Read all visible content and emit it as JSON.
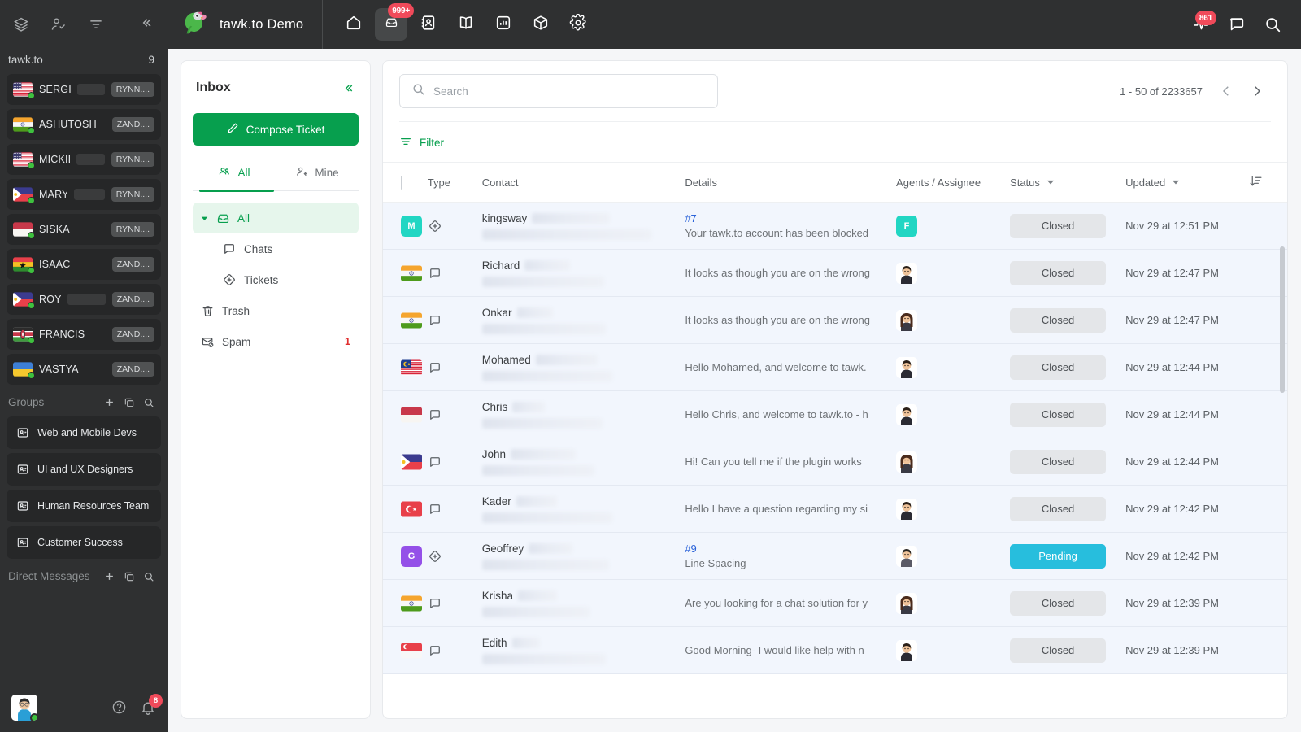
{
  "sidebar": {
    "toolbar_icons": [
      "layers-icon",
      "user-check-icon",
      "filter-icon",
      "collapse-left-icon"
    ],
    "property": {
      "title": "tawk.to",
      "count": "9"
    },
    "contacts": [
      {
        "name": "SERGIO",
        "flag": "us",
        "tag": "RYNN....",
        "redacted": true,
        "redact_w": 44
      },
      {
        "name": "ASHUTOSH",
        "flag": "in",
        "tag": "ZAND....",
        "redacted": false,
        "redact_w": 0
      },
      {
        "name": "MICKIE",
        "flag": "us",
        "tag": "RYNN....",
        "redacted": true,
        "redact_w": 40
      },
      {
        "name": "MARY",
        "flag": "ph",
        "tag": "RYNN....",
        "redacted": true,
        "redact_w": 40
      },
      {
        "name": "SISKA",
        "flag": "id",
        "tag": "RYNN....",
        "redacted": false,
        "redact_w": 0
      },
      {
        "name": "ISAAC",
        "flag": "gh",
        "tag": "ZAND....",
        "redacted": false,
        "redact_w": 0
      },
      {
        "name": "ROY",
        "flag": "ph",
        "tag": "ZAND....",
        "redacted": true,
        "redact_w": 48
      },
      {
        "name": "FRANCIS",
        "flag": "ke",
        "tag": "ZAND....",
        "redacted": false,
        "redact_w": 0
      },
      {
        "name": "VASTYA",
        "flag": "ua",
        "tag": "ZAND....",
        "redacted": false,
        "redact_w": 0
      }
    ],
    "groups_header": {
      "label": "Groups",
      "actions": [
        "add-icon",
        "copy-icon",
        "search-icon"
      ]
    },
    "groups": [
      {
        "label": "Web and Mobile Devs"
      },
      {
        "label": "UI and UX Designers"
      },
      {
        "label": "Human Resources Team"
      },
      {
        "label": "Customer Success"
      }
    ],
    "direct_messages_header": {
      "label": "Direct Messages",
      "actions": [
        "add-icon",
        "copy-icon",
        "search-icon"
      ]
    },
    "bottom": {
      "help_icon": "help-circle-icon",
      "bell_icon": "bell-icon",
      "bell_badge": "8"
    }
  },
  "topbar": {
    "brand": "tawk.to Demo",
    "logo_icon": "parrot-logo-icon",
    "nav": [
      {
        "name": "home-icon",
        "badge": "",
        "active": false
      },
      {
        "name": "inbox-icon",
        "badge": "999+",
        "active": true
      },
      {
        "name": "contacts-icon",
        "badge": "",
        "active": false
      },
      {
        "name": "knowledge-base-icon",
        "badge": "",
        "active": false
      },
      {
        "name": "monitoring-icon",
        "badge": "",
        "active": false
      },
      {
        "name": "apps-icon",
        "badge": "",
        "active": false
      },
      {
        "name": "settings-icon",
        "badge": "",
        "active": false
      }
    ],
    "right": [
      {
        "name": "activity-icon",
        "badge": "861"
      },
      {
        "name": "chat-icon",
        "badge": ""
      },
      {
        "name": "search-icon",
        "badge": ""
      }
    ]
  },
  "inbox": {
    "title": "Inbox",
    "collapse_icon": "collapse-left-icon",
    "compose_label": "Compose Ticket",
    "compose_icon": "pencil-icon",
    "tabs": [
      {
        "label": "All",
        "icon": "people-icon",
        "active": true
      },
      {
        "label": "Mine",
        "icon": "person-in-icon",
        "active": false
      }
    ],
    "nav_items": [
      {
        "label": "All",
        "icon": "inbox-icon",
        "selected": true,
        "child": false,
        "caret": true,
        "count": ""
      },
      {
        "label": "Chats",
        "icon": "chat-icon",
        "selected": false,
        "child": true,
        "caret": false,
        "count": ""
      },
      {
        "label": "Tickets",
        "icon": "ticket-icon",
        "selected": false,
        "child": true,
        "caret": false,
        "count": ""
      },
      {
        "label": "Trash",
        "icon": "trash-icon",
        "selected": false,
        "child": false,
        "caret": false,
        "count": ""
      },
      {
        "label": "Spam",
        "icon": "spam-icon",
        "selected": false,
        "child": false,
        "caret": false,
        "count": "1"
      }
    ]
  },
  "main": {
    "search": {
      "placeholder": "Search",
      "value": "",
      "icon": "search-icon"
    },
    "pagination": {
      "label": "1 - 50 of 2233657",
      "prev_icon": "chevron-left-icon",
      "next_icon": "chevron-right-icon"
    },
    "filter": {
      "label": "Filter",
      "icon": "filter-icon"
    },
    "columns": [
      {
        "key": "check",
        "label": ""
      },
      {
        "key": "type",
        "label": "Type"
      },
      {
        "key": "contact",
        "label": "Contact"
      },
      {
        "key": "details",
        "label": "Details"
      },
      {
        "key": "agent",
        "label": "Agents / Assignee"
      },
      {
        "key": "status",
        "label": "Status",
        "sortable": true
      },
      {
        "key": "updated",
        "label": "Updated",
        "sortable": true
      },
      {
        "key": "sort",
        "label": ""
      }
    ],
    "rows": [
      {
        "avatar_type": "letter",
        "avatar_letter": "M",
        "avatar_color": "#21d6c3",
        "flag": "",
        "type_icon": "ticket-icon",
        "contact_first": "kingsway",
        "redact1_w": 96,
        "redact2_w": 208,
        "ticket_no": "#7",
        "details": "Your tawk.to account has been blocked",
        "agent_kind": "letter",
        "agent_letter": "F",
        "agent_color": "#21d6c3",
        "status": "Closed",
        "status_kind": "closed",
        "updated": "Nov 29 at 12:51 PM"
      },
      {
        "avatar_type": "flag",
        "flag": "in",
        "type_icon": "chat-icon",
        "contact_first": "Richard",
        "redact1_w": 56,
        "redact2_w": 150,
        "ticket_no": "",
        "details": "It looks as though you are on the wrong",
        "agent_kind": "photo",
        "agent_photo": "f1",
        "status": "Closed",
        "status_kind": "closed",
        "updated": "Nov 29 at 12:47 PM"
      },
      {
        "avatar_type": "flag",
        "flag": "in",
        "type_icon": "chat-icon",
        "contact_first": "Onkar",
        "redact1_w": 44,
        "redact2_w": 152,
        "ticket_no": "",
        "details": "It looks as though you are on the wrong",
        "agent_kind": "photo",
        "agent_photo": "f2",
        "status": "Closed",
        "status_kind": "closed",
        "updated": "Nov 29 at 12:47 PM"
      },
      {
        "avatar_type": "flag",
        "flag": "my",
        "type_icon": "chat-icon",
        "contact_first": "Mohamed",
        "redact1_w": 76,
        "redact2_w": 160,
        "ticket_no": "",
        "details": "Hello Mohamed, and welcome to tawk.",
        "agent_kind": "photo",
        "agent_photo": "f1",
        "status": "Closed",
        "status_kind": "closed",
        "updated": "Nov 29 at 12:44 PM"
      },
      {
        "avatar_type": "flag",
        "flag": "id",
        "type_icon": "chat-icon",
        "contact_first": "Chris",
        "redact1_w": 40,
        "redact2_w": 148,
        "ticket_no": "",
        "details": "Hello Chris, and welcome to tawk.to - h",
        "agent_kind": "photo",
        "agent_photo": "f1",
        "status": "Closed",
        "status_kind": "closed",
        "updated": "Nov 29 at 12:44 PM"
      },
      {
        "avatar_type": "flag",
        "flag": "ph",
        "type_icon": "chat-icon",
        "contact_first": "John",
        "redact1_w": 80,
        "redact2_w": 138,
        "ticket_no": "",
        "details": "Hi! Can you tell me if the plugin works",
        "agent_kind": "photo",
        "agent_photo": "f2",
        "status": "Closed",
        "status_kind": "closed",
        "updated": "Nov 29 at 12:44 PM"
      },
      {
        "avatar_type": "flag",
        "flag": "tr",
        "type_icon": "chat-icon",
        "contact_first": "Kader",
        "redact1_w": 50,
        "redact2_w": 160,
        "ticket_no": "",
        "details": "Hello I have a question regarding my si",
        "agent_kind": "photo",
        "agent_photo": "f1",
        "status": "Closed",
        "status_kind": "closed",
        "updated": "Nov 29 at 12:42 PM"
      },
      {
        "avatar_type": "letter",
        "avatar_letter": "G",
        "avatar_color": "#9450e8",
        "flag": "",
        "type_icon": "ticket-icon",
        "contact_first": "Geoffrey",
        "redact1_w": 54,
        "redact2_w": 156,
        "ticket_no": "#9",
        "details": "Line Spacing",
        "agent_kind": "photo",
        "agent_photo": "m1",
        "status": "Pending",
        "status_kind": "pending",
        "updated": "Nov 29 at 12:42 PM"
      },
      {
        "avatar_type": "flag",
        "flag": "in",
        "type_icon": "chat-icon",
        "contact_first": "Krisha",
        "redact1_w": 48,
        "redact2_w": 132,
        "ticket_no": "",
        "details": "Are you looking for a chat solution for y",
        "agent_kind": "photo",
        "agent_photo": "f2",
        "status": "Closed",
        "status_kind": "closed",
        "updated": "Nov 29 at 12:39 PM"
      },
      {
        "avatar_type": "flag",
        "flag": "sg",
        "type_icon": "chat-icon",
        "contact_first": "Edith",
        "redact1_w": 34,
        "redact2_w": 152,
        "ticket_no": "",
        "details": "Good Morning- I would like help with n",
        "agent_kind": "photo",
        "agent_photo": "f1",
        "status": "Closed",
        "status_kind": "closed",
        "updated": "Nov 29 at 12:39 PM"
      }
    ]
  },
  "colors": {
    "brand_green": "#079f4e",
    "badge_red": "#f04a5a",
    "pending_cyan": "#27bedd",
    "ticket_link": "#2b63d9",
    "sidebar_bg": "#2f3031",
    "row_bg": "#f2f6fd"
  }
}
